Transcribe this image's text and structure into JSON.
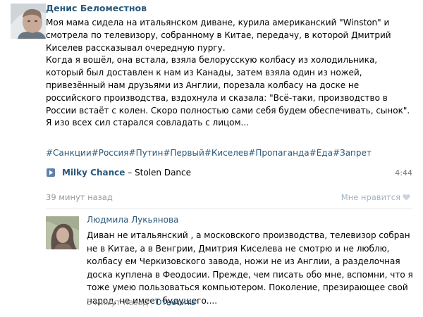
{
  "post": {
    "author": "Денис Беломестнов",
    "paragraphs": [
      "Моя мама сидела на итальянском диване, курила американский \"Winston\" и смотрела по телевизору, собранному в Китае, передачу, в которой Дмитрий Киселев рассказывал очередную пургу.",
      "Когда я вошёл, она встала, взяла белорусскую колбасу из холодильника, который был доставлен к нам из Канады, затем взяла один из ножей, привезённый нам друзьями из Англии, порезала колбасу на доске не российского производства, вздохнула и сказала: \"Всё-таки, производство в России встаёт с колен. Скоро полностью сами себя будем обеспечивать, сынок\".",
      "Я изо всех сил старался совладать с лицом..."
    ],
    "hashtags": [
      "#Санкции",
      "#Россия",
      "#Путин",
      "#Первый",
      "#Киселев",
      "#Пропаганда",
      "#Еда",
      "#Запрет"
    ],
    "audio": {
      "artist": "Milky Chance",
      "separator": " – ",
      "title": "Stolen Dance",
      "duration": "4:44"
    },
    "time": "39 минут назад",
    "like_label": "Мне нравится"
  },
  "reply": {
    "author": "Людмила Лукьянова",
    "text": "Диван не итальянский , а московского производства, телевизор собран не в Китае, а в Венгрии, Дмитрия Киселева не смотрю и не люблю, колбасу ем Черкизовского завода, ножи не из Англии, а разделочная доска куплена в Феодосии. Прежде, чем писать обо мне, вспомни, что я тоже умею пользоваться компьютером. Поколение, презирающее свой народ, не имеет будущего....",
    "time": "5 минут назад",
    "separator": "|",
    "reply_label": "Ответить"
  },
  "colors": {
    "link": "#2b587a",
    "meta": "#999999",
    "like": "#a3b3c4",
    "play_button": "#5e82a8",
    "divider": "#e4e8ec"
  },
  "icons": {
    "play": "play-icon",
    "like": "heart-icon"
  }
}
